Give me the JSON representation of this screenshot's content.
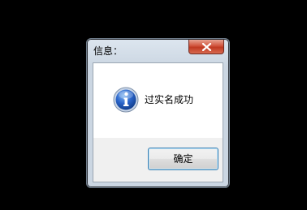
{
  "dialog": {
    "title": "信息：",
    "message": "过实名成功",
    "ok_label": "确定"
  },
  "icons": {
    "info": "info-icon",
    "close": "close-icon"
  },
  "colors": {
    "background": "#000000",
    "close_button": "#c8452d",
    "ok_focus_border": "#3c7fb1"
  }
}
